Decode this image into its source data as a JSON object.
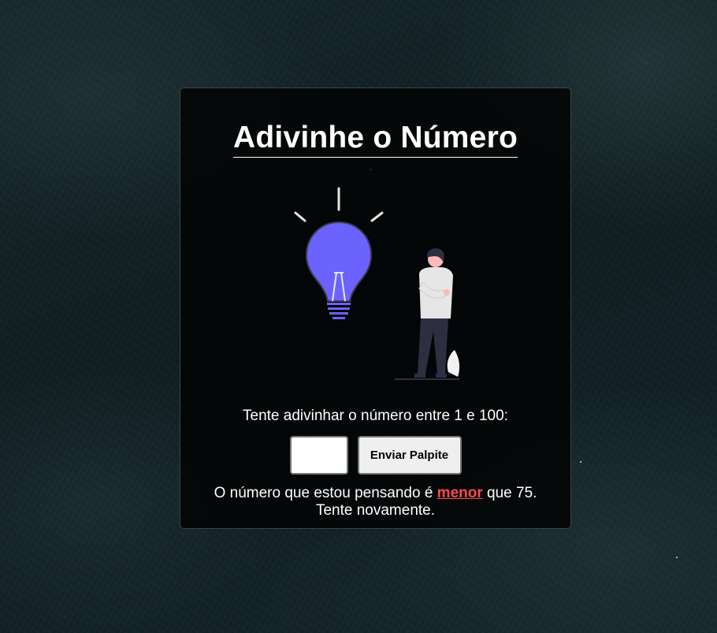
{
  "game": {
    "title": "Adivinhe o Número",
    "prompt": "Tente adivinhar o número entre 1 e 100:",
    "input": {
      "value": "",
      "placeholder": ""
    },
    "submit_label": "Enviar Palpite",
    "feedback": {
      "before": "O número que estou pensando é ",
      "hint": "menor",
      "after": " que 75. Tente novamente.",
      "hint_color": "#ff4a4a"
    }
  },
  "illustration": {
    "bulb_color": "#6c63ff",
    "icon": "lightbulb-idea-person"
  }
}
